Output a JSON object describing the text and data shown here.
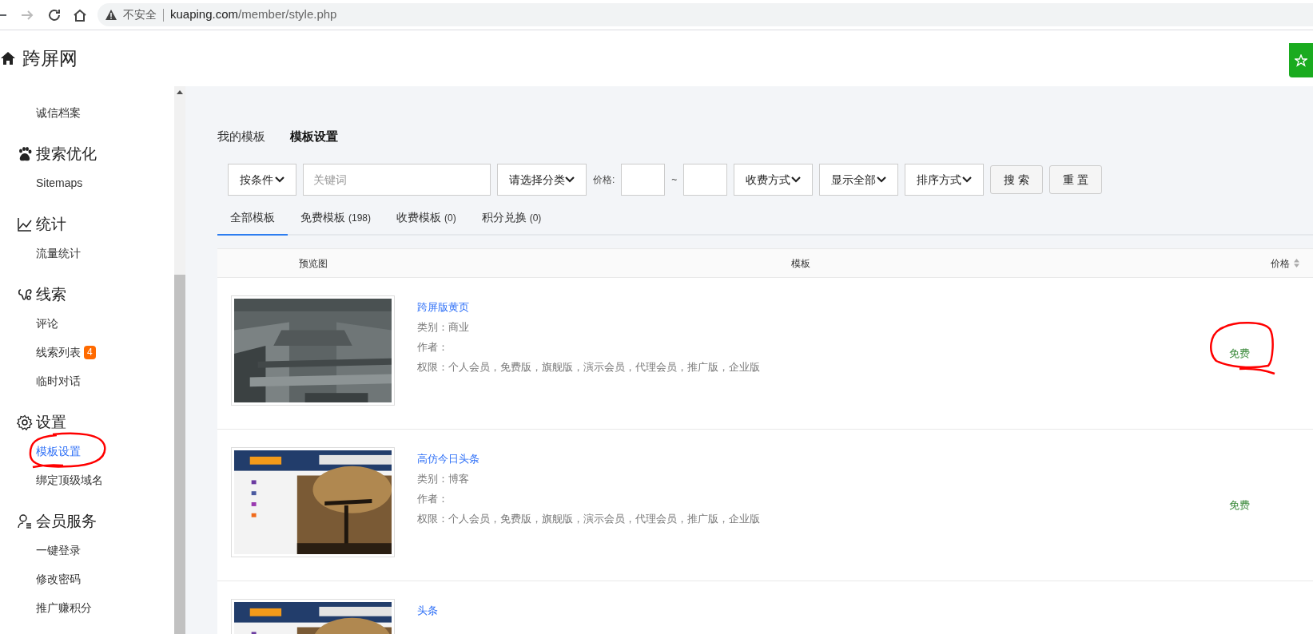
{
  "browser": {
    "security": "不安全",
    "url_host": "kuaping.com",
    "url_path": "/member/style.php"
  },
  "header": {
    "site_name": "跨屏网"
  },
  "sidebar": {
    "groups": [
      {
        "items": [
          {
            "label": "诚信档案",
            "selected": false
          }
        ]
      },
      {
        "title": "搜索优化",
        "items": [
          {
            "label": "Sitemaps",
            "selected": false
          }
        ]
      },
      {
        "title": "统计",
        "items": [
          {
            "label": "流量统计",
            "selected": false
          }
        ]
      },
      {
        "title": "线索",
        "items": [
          {
            "label": "评论",
            "selected": false
          },
          {
            "label": "线索列表",
            "selected": false,
            "badge": "4"
          },
          {
            "label": "临时对话",
            "selected": false
          }
        ]
      },
      {
        "title": "设置",
        "items": [
          {
            "label": "模板设置",
            "selected": true
          },
          {
            "label": "绑定顶级域名",
            "selected": false
          }
        ]
      },
      {
        "title": "会员服务",
        "items": [
          {
            "label": "一键登录",
            "selected": false
          },
          {
            "label": "修改密码",
            "selected": false
          },
          {
            "label": "推广赚积分",
            "selected": false
          }
        ]
      }
    ]
  },
  "page_tabs": [
    {
      "label": "我的模板",
      "selected": false
    },
    {
      "label": "模板设置",
      "selected": true
    }
  ],
  "filters": [
    {
      "kind": "select",
      "value": "按条件"
    },
    {
      "kind": "input",
      "placeholder": "关键词"
    },
    {
      "kind": "select",
      "value": "请选择分类"
    },
    {
      "kind": "label",
      "text": "价格:"
    },
    {
      "kind": "input"
    },
    {
      "kind": "label",
      "text": "~"
    },
    {
      "kind": "input"
    },
    {
      "kind": "select",
      "value": "收费方式"
    },
    {
      "kind": "select",
      "value": "显示全部"
    },
    {
      "kind": "select",
      "value": "排序方式"
    },
    {
      "kind": "button",
      "text": "搜 索"
    },
    {
      "kind": "button",
      "text": "重 置"
    }
  ],
  "category_tabs": [
    {
      "label": "全部模板",
      "selected": true
    },
    {
      "label": "免费模板",
      "count": "(198)",
      "selected": false
    },
    {
      "label": "收费模板",
      "count": "(0)",
      "selected": false
    },
    {
      "label": "积分兑换",
      "count": "(0)",
      "selected": false
    }
  ],
  "table": {
    "columns": [
      "预览图",
      "模板",
      "价格"
    ],
    "rows": [
      {
        "title": "跨屏版黄页",
        "category": "类别：商业",
        "author": "作者：",
        "permissions": "权限：个人会员，免费版，旗舰版，演示会员，代理会员，推广版，企业版",
        "price": "免费"
      },
      {
        "title": "高仿今日头条",
        "category": "类别：博客",
        "author": "作者：",
        "permissions": "权限：个人会员，免费版，旗舰版，演示会员，代理会员，推广版，企业版",
        "price": "免费"
      },
      {
        "title": "头条"
      }
    ]
  }
}
